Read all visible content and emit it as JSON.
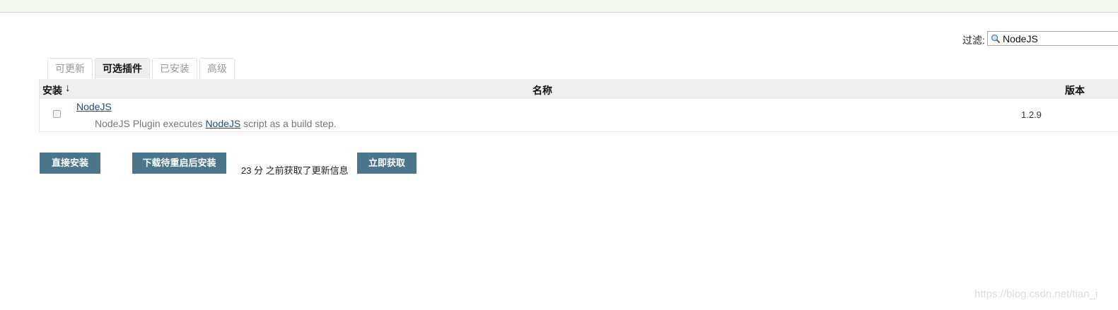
{
  "filter": {
    "label": "过滤:",
    "value": "NodeJS",
    "icon": "search-icon"
  },
  "tabs": [
    {
      "label": "可更新",
      "active": false
    },
    {
      "label": "可选插件",
      "active": true
    },
    {
      "label": "已安装",
      "active": false
    },
    {
      "label": "高级",
      "active": false
    }
  ],
  "table": {
    "headers": {
      "install": "安装",
      "sort_arrow": "↓",
      "name": "名称",
      "version": "版本"
    },
    "rows": [
      {
        "checked": false,
        "name": "NodeJS",
        "desc_prefix": "NodeJS Plugin executes ",
        "desc_link": "NodeJS",
        "desc_suffix": " script as a build step.",
        "version": "1.2.9"
      }
    ]
  },
  "actions": {
    "install_now": "直接安装",
    "download_restart": "下载待重启后安装",
    "update_info": "23 分 之前获取了更新信息",
    "fetch_now": "立即获取"
  },
  "watermark": "https://blog.csdn.net/tian_i",
  "colors": {
    "button_bg": "#4b758b",
    "link": "#204a87",
    "header_bg": "#efefef"
  }
}
